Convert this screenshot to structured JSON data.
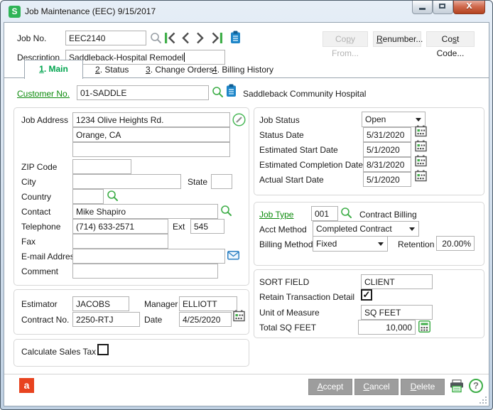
{
  "window": {
    "title": "Job Maintenance (EEC) 9/15/2017",
    "logo_glyph": "S"
  },
  "toolbar": {
    "job_no_label": "Job No.",
    "job_no_value": "EEC2140",
    "description_label": "Description",
    "description_value": "Saddleback-Hospital Remodel",
    "copy_from": {
      "pre": "Co",
      "mn": "p",
      "post": "y From..."
    },
    "renumber": {
      "pre": "",
      "mn": "R",
      "post": "enumber..."
    },
    "cost_code": {
      "pre": "Co",
      "mn": "s",
      "post": "t Code..."
    }
  },
  "tabs": [
    {
      "num": "1",
      "rest": ". Main",
      "active": true
    },
    {
      "num": "2",
      "rest": ". Status",
      "active": false
    },
    {
      "num": "3",
      "rest": ". Change Orders",
      "active": false
    },
    {
      "num": "4",
      "rest": ". Billing History",
      "active": false
    }
  ],
  "customer": {
    "label": "Customer No.",
    "value": "01-SADDLE",
    "name": "Saddleback Community Hospital"
  },
  "address": {
    "job_address_label": "Job Address",
    "line1": "1234 Olive Heights Rd.",
    "line2": "Orange, CA",
    "line3": "",
    "zip_label": "ZIP Code",
    "zip": "",
    "city_label": "City",
    "city": "",
    "state_label": "State",
    "state": "",
    "country_label": "Country",
    "country": "",
    "contact_label": "Contact",
    "contact": "Mike Shapiro",
    "telephone_label": "Telephone",
    "telephone": "(714) 633-2571",
    "ext_label": "Ext",
    "ext": "545",
    "fax_label": "Fax",
    "fax": "",
    "email_label": "E-mail Address",
    "email": "",
    "comment_label": "Comment",
    "comment": ""
  },
  "estimator_group": {
    "estimator_label": "Estimator",
    "estimator": "JACOBS",
    "manager_label": "Manager",
    "manager": "ELLIOTT",
    "contract_label": "Contract No.",
    "contract": "2250-RTJ",
    "date_label": "Date",
    "date": "4/25/2020"
  },
  "sales_tax": {
    "label": "Calculate Sales Tax",
    "checked": false,
    "check_glyph": ""
  },
  "status_group": {
    "job_status_label": "Job Status",
    "job_status": "Open",
    "status_date_label": "Status Date",
    "status_date": "5/31/2020",
    "estimated_start_label": "Estimated Start Date",
    "estimated_start": "5/1/2020",
    "estimated_completion_label": "Estimated Completion Date",
    "estimated_completion": "8/31/2020",
    "actual_start_label": "Actual Start Date",
    "actual_start": "5/1/2020"
  },
  "job_type_group": {
    "job_type_label": "Job Type",
    "job_type": "001",
    "job_type_desc": "Contract Billing",
    "acct_method_label": "Acct Method",
    "acct_method": "Completed Contract",
    "billing_method_label": "Billing Method",
    "billing_method": "Fixed",
    "retention_label": "Retention",
    "retention": "20.00%"
  },
  "sort_group": {
    "sort_field_label": "SORT FIELD",
    "sort_field": "CLIENT",
    "retain_label": "Retain Transaction Detail",
    "retain_checked": true,
    "check_glyph": "✓",
    "uom_label": "Unit of Measure",
    "uom": "SQ FEET",
    "total_label": "Total SQ FEET",
    "total": "10,000"
  },
  "footer": {
    "accept": {
      "mn": "A",
      "post": "ccept"
    },
    "cancel": {
      "mn": "C",
      "post": "ancel"
    },
    "delete": {
      "mn": "D",
      "post": "elete"
    },
    "office_glyph": "a",
    "help_glyph": "?"
  },
  "colors": {
    "sage_green": "#3fae49",
    "link_green": "#0b8a0b",
    "active_tab_green": "#00a44e",
    "button_gray": "#9d9d9d",
    "office_orange": "#e8431f",
    "clipboard_blue": "#1e86c8",
    "close_red": "#b2431f"
  }
}
